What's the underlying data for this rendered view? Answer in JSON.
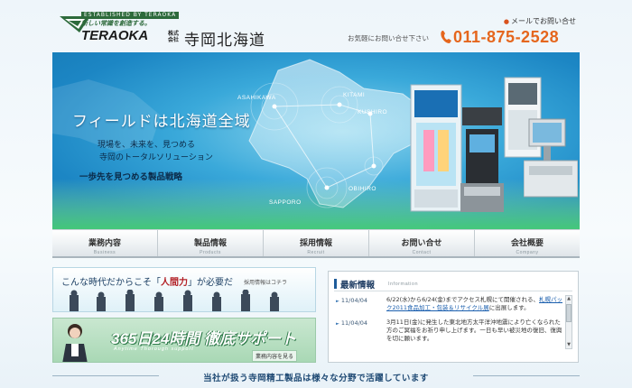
{
  "header": {
    "logo_tagline_top": "ESTABLISHED BY TERAOKA",
    "logo_tagline": "新しい常識を創造する。",
    "logo_brand": "TERAOKA",
    "logo_kabushiki": "株式会社",
    "company_name": "寺岡北海道",
    "mail_link": "メールでお問い合せ",
    "tel_label": "お気軽にお問い合せ下さい",
    "tel_number": "011-875-2528",
    "accent_color": "#e5661d"
  },
  "hero": {
    "title": "フィールドは北海道全域",
    "line1": "現場を、未来を、見つめる",
    "line2": "寺岡のトータルソリューション",
    "line3": "一歩先を見つめる製品戦略",
    "cities": [
      "ASAHIKAWA",
      "KITAMI",
      "KUSHIRO",
      "OBIHIRO",
      "SAPPORO"
    ]
  },
  "nav": [
    {
      "label": "業務内容",
      "sub": "Business"
    },
    {
      "label": "製品情報",
      "sub": "Products"
    },
    {
      "label": "採用情報",
      "sub": "Recruit"
    },
    {
      "label": "お問い合せ",
      "sub": "Contact"
    },
    {
      "label": "会社概要",
      "sub": "Company"
    }
  ],
  "banner_recruit": {
    "text_before": "こんな時代だからこそ「",
    "text_strong": "人間力",
    "text_after": "」が必要だ",
    "link": "採用情報はコチラ"
  },
  "banner_support": {
    "title": "365日24時間 徹底サポート",
    "sub": "Anytime Thorough support",
    "link": "業務内容を見る"
  },
  "news": {
    "title": "最新情報",
    "sub": "Information",
    "items": [
      {
        "date": "11/04/04",
        "text_before": "6/22(水)から6/24(金)までアクセス札幌にて開催される、",
        "link": "札幌パック2011食品加工・包装＆リサイクル展",
        "text_after": "に出展します。"
      },
      {
        "date": "11/04/04",
        "text_before": "3月11日(金)に発生した東北地方太平洋沖地震により亡くなられた方のご冥福をお祈り申し上げます。一日も早い被災地の復旧、復興を切に願います。",
        "link": "",
        "text_after": ""
      }
    ]
  },
  "tagline": "当社が扱う寺岡精工製品は様々な分野で活躍しています"
}
